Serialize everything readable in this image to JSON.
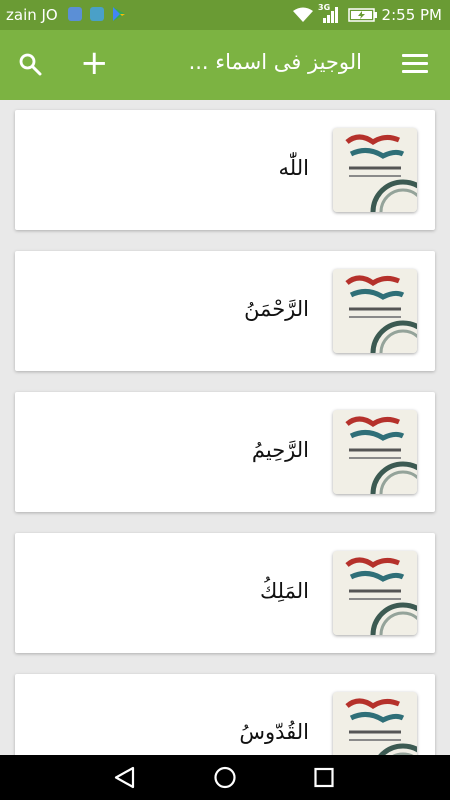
{
  "status_bar": {
    "carrier": "zain JO",
    "network": "3G",
    "time": "2:55 PM"
  },
  "app_bar": {
    "title": "الوجيز فى اسماء ...",
    "add_label": "+"
  },
  "items": [
    {
      "label": "اللّٰه"
    },
    {
      "label": "الرَّحْمَنُ"
    },
    {
      "label": "الرَّحِيمُ"
    },
    {
      "label": "المَلِكُ"
    },
    {
      "label": "القُدّوسُ"
    }
  ],
  "colors": {
    "status_bar": "#6a9b34",
    "app_bar": "#7cb342",
    "background": "#e9e9e9"
  }
}
